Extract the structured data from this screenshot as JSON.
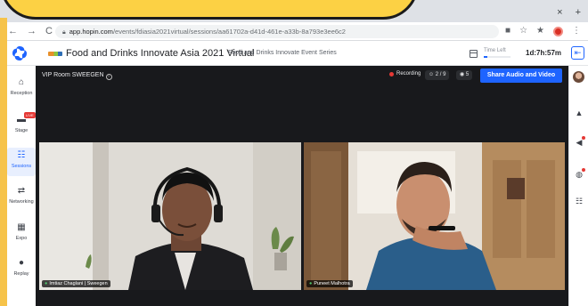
{
  "browser": {
    "tab_controls": [
      "×",
      "+",
      "⌄"
    ],
    "nav": [
      "←",
      "→",
      "C"
    ],
    "url_host": "app.hopin.com",
    "url_path": "/events/fdiasia2021virtual/sessions/aa61702a-d41d-461e-a33b-8a793e3ee6c2",
    "extension_icons": [
      "■",
      "☆",
      "★"
    ]
  },
  "header": {
    "event_title": "Food and Drinks Innovate Asia 2021 Virtual",
    "event_subtitle": "Food and Drinks Innovate Event Series",
    "time_left_label": "Time Left",
    "time_left_value": "1d:7h:57m",
    "time_left_progress": 0.12,
    "collapse_glyph": "⇤"
  },
  "nav": {
    "items": [
      {
        "label": "Reception",
        "icon": "home-icon",
        "glyph": "⌂"
      },
      {
        "label": "Stage",
        "icon": "stage-icon",
        "glyph": "▬",
        "badge": "LIVE"
      },
      {
        "label": "Sessions",
        "icon": "sessions-icon",
        "glyph": "☷",
        "active": true
      },
      {
        "label": "Networking",
        "icon": "networking-icon",
        "glyph": "⇄"
      },
      {
        "label": "Expo",
        "icon": "expo-icon",
        "glyph": "▦"
      },
      {
        "label": "Replay",
        "icon": "replay-icon",
        "glyph": "●"
      }
    ]
  },
  "session": {
    "room_name": "VIP Room SWEEGEN",
    "recording_label": "Recording",
    "participants_count": "2 / 9",
    "viewers_count": "5",
    "share_button": "Share Audio and Video",
    "videos": [
      {
        "name": "Imtiaz Chaglani | Sweegen"
      },
      {
        "name": "Puneet Malhotra"
      }
    ]
  },
  "rightrail": {
    "icons": [
      "avatar",
      "bell-icon",
      "megaphone-icon",
      "globe-icon",
      "people-icon"
    ]
  },
  "colors": {
    "accent": "#1e64ff",
    "frame_yellow": "#f6c34a",
    "recording_red": "#e53935"
  }
}
